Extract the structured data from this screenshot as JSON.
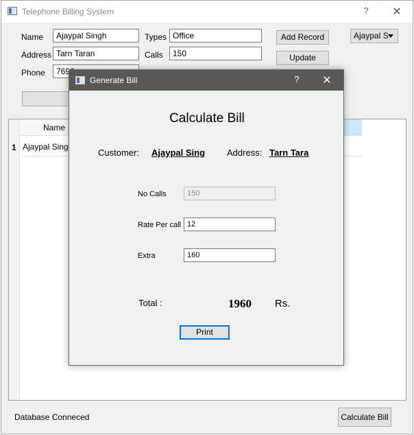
{
  "window": {
    "title": "Telephone Billing System",
    "help": "?",
    "close": "✕"
  },
  "form": {
    "name_label": "Name",
    "name_value": "Ajaypal Singh",
    "address_label": "Address",
    "address_value": "Tarn Taran",
    "phone_label": "Phone",
    "phone_value": "7696",
    "types_label": "Types",
    "types_value": "Office",
    "calls_label": "Calls",
    "calls_value": "150",
    "add_record_label": "Add Record",
    "update_label": "Update",
    "customer_select_value": "Ajaypal S"
  },
  "table": {
    "columns": [
      "Name"
    ],
    "rows": [
      {
        "num": "1",
        "name": "Ajaypal Singh"
      }
    ]
  },
  "status_text": "Database Conneced",
  "calculate_bill_label": "Calculate Bill",
  "dialog": {
    "title": "Generate Bill",
    "help": "?",
    "close": "✕",
    "heading": "Calculate Bill",
    "customer_label": "Customer:",
    "customer_value": "Ajaypal Sing",
    "address_label": "Address:",
    "address_value": "Tarn Tara",
    "no_calls_label": "No Calls",
    "no_calls_value": "150",
    "rate_label": "Rate Per call",
    "rate_value": "12",
    "extra_label": "Extra",
    "extra_value": "160",
    "total_label": "Total :",
    "total_value": "1960",
    "total_unit": "Rs.",
    "print_label": "Print"
  }
}
